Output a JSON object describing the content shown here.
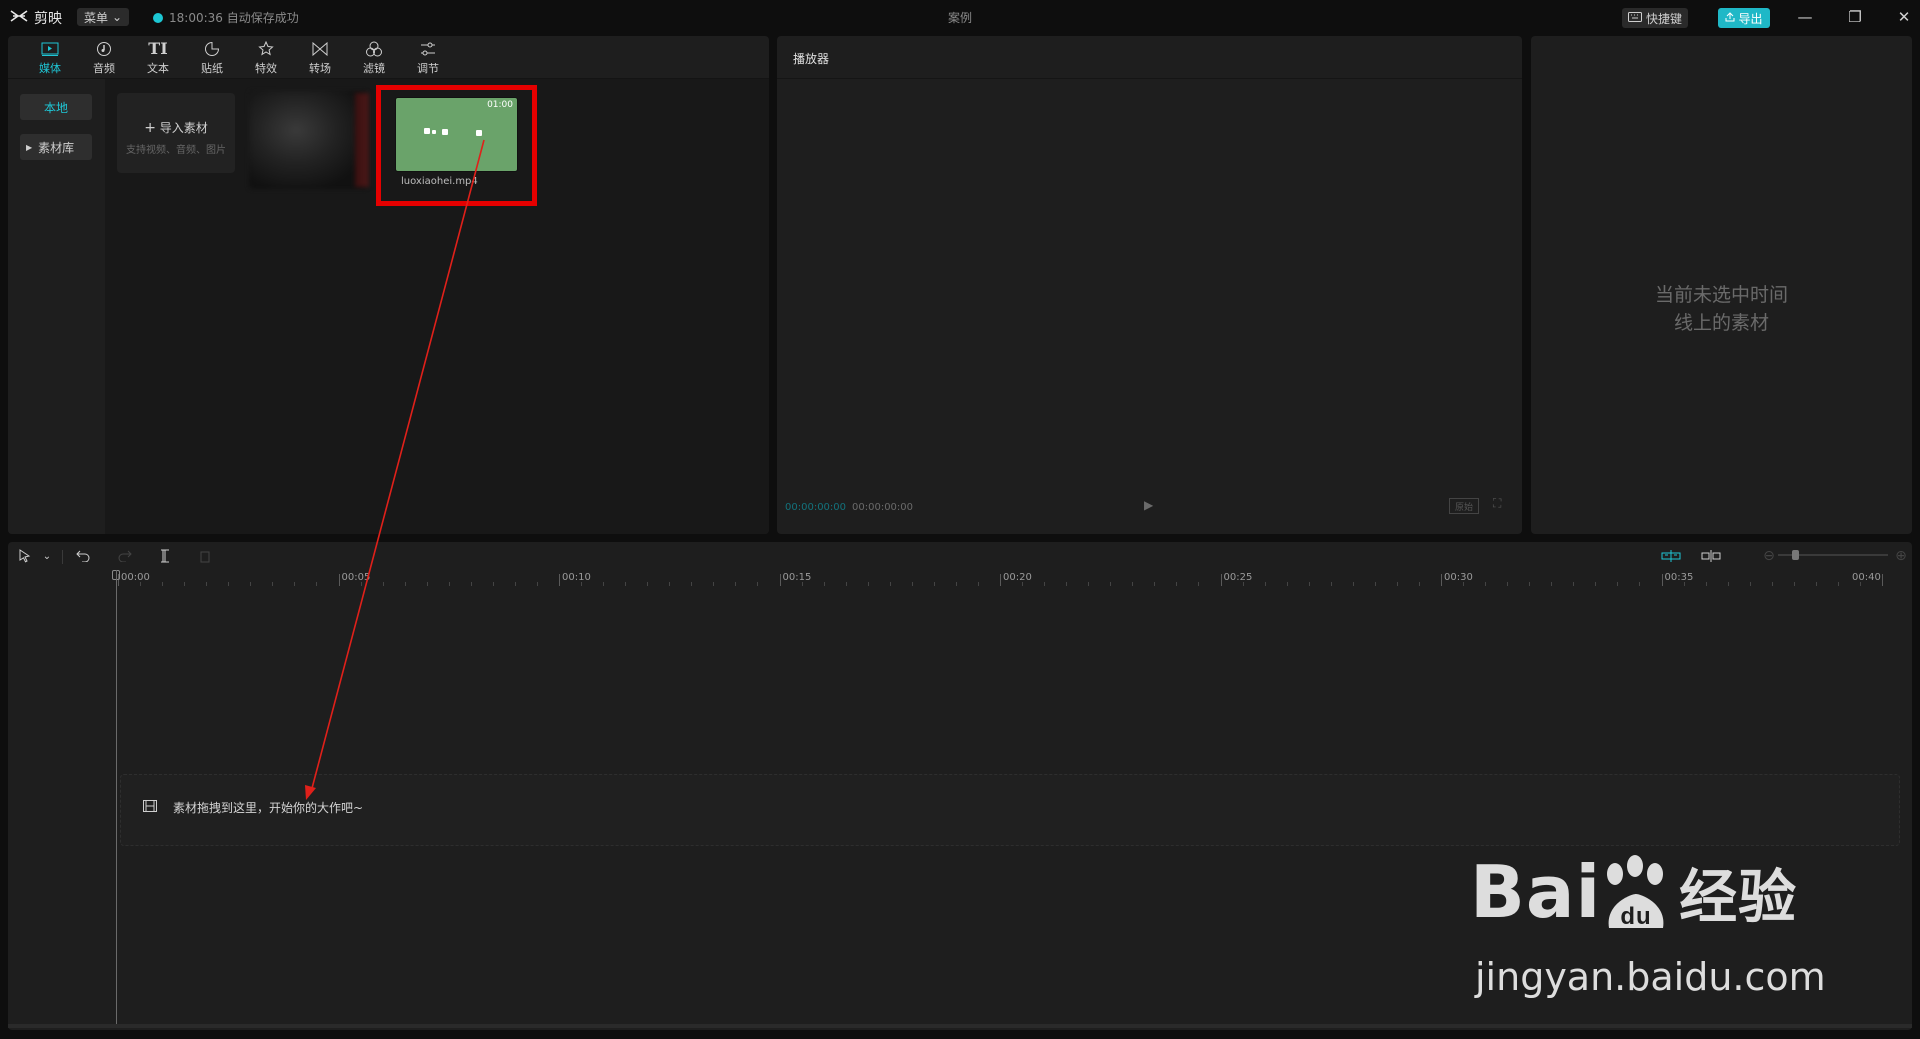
{
  "titlebar": {
    "app_name": "剪映",
    "menu_label": "菜单",
    "save_status": "18:00:36 自动保存成功",
    "project_title": "案例",
    "shortcut_label": "快捷键",
    "export_label": "导出"
  },
  "media_panel": {
    "tabs": [
      {
        "label": "媒体",
        "icon": "media-icon",
        "active": true
      },
      {
        "label": "音频",
        "icon": "audio-icon"
      },
      {
        "label": "文本",
        "icon": "text-icon"
      },
      {
        "label": "贴纸",
        "icon": "sticker-icon"
      },
      {
        "label": "特效",
        "icon": "effects-icon"
      },
      {
        "label": "转场",
        "icon": "transition-icon"
      },
      {
        "label": "滤镜",
        "icon": "filter-icon"
      },
      {
        "label": "调节",
        "icon": "adjust-icon"
      }
    ],
    "sidebar": {
      "local_label": "本地",
      "library_label": "素材库"
    },
    "import": {
      "label": "导入素材",
      "sublabel": "支持视频、音频、图片"
    },
    "video": {
      "duration": "01:00",
      "filename": "luoxiaohei.mp4"
    }
  },
  "player": {
    "title": "播放器",
    "time_current": "00:00:00:00",
    "time_total": "00:00:00:00",
    "ratio_label": "原始"
  },
  "attributes": {
    "placeholder_line1": "当前未选中时间",
    "placeholder_line2": "线上的素材"
  },
  "timeline": {
    "ticks": [
      "00:00",
      "00:05",
      "00:10",
      "00:15",
      "00:20",
      "00:25",
      "00:30",
      "00:35",
      "00:40"
    ],
    "drop_hint": "素材拖拽到这里，开始你的大作吧~"
  },
  "watermark": {
    "brand": "Bai",
    "brand_du": "du",
    "brand_cn": "经验",
    "url": "jingyan.baidu.com"
  },
  "colors": {
    "accent": "#1fc6d5",
    "highlight_box": "#e50000",
    "arrow": "#e0201a"
  }
}
